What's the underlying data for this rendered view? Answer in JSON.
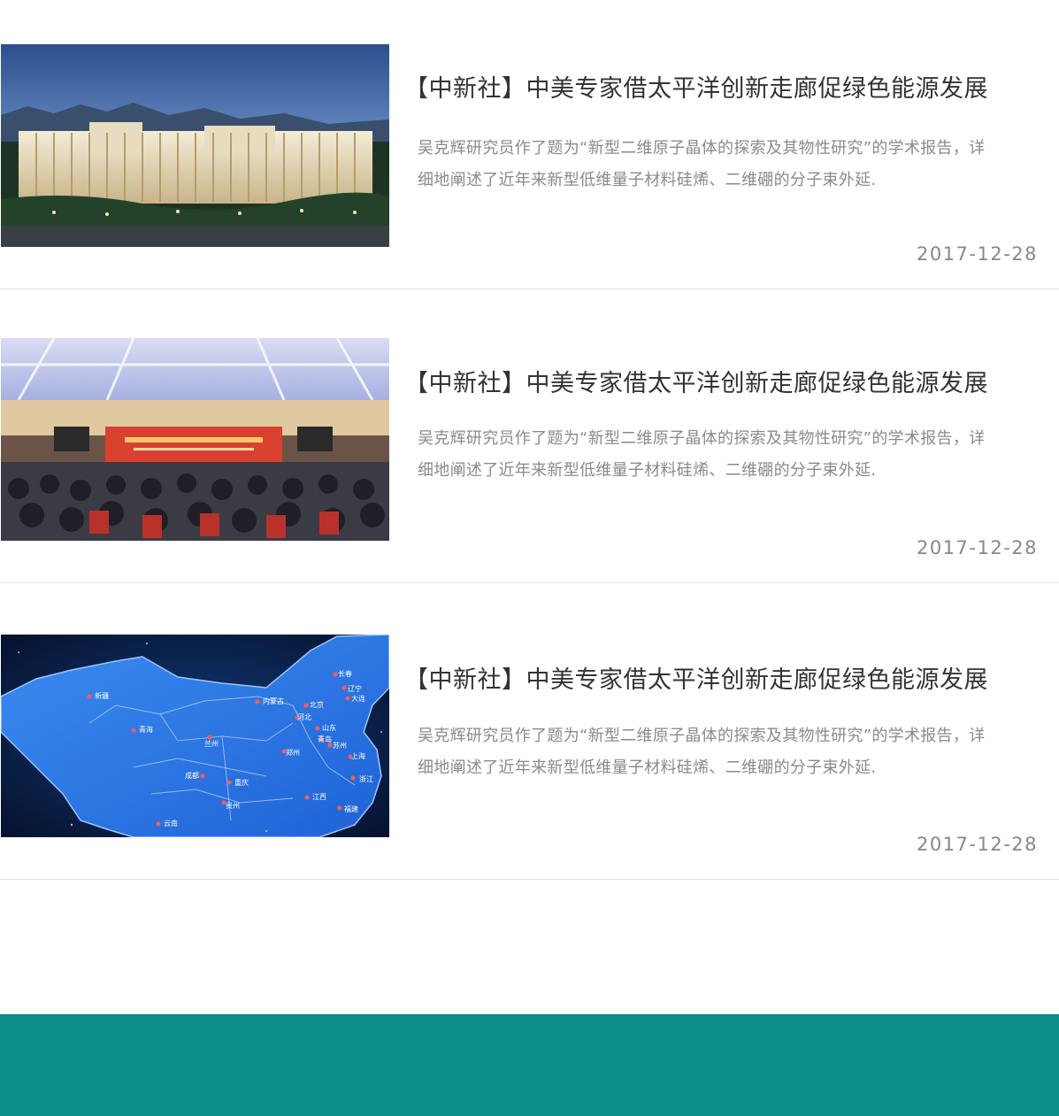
{
  "news": [
    {
      "title": "【中新社】中美专家借太平洋创新走廊促绿色能源发展",
      "summary": "吴克辉研究员作了题为“新型二维原子晶体的探索及其物性研究”的学术报告，详细地阐述了近年来新型低维量子材料硅烯、二维硼的分子束外延.",
      "date": "2017-12-28",
      "image": "building-photo"
    },
    {
      "title": "【中新社】中美专家借太平洋创新走廊促绿色能源发展",
      "summary": "吴克辉研究员作了题为“新型二维原子晶体的探索及其物性研究”的学术报告，详细地阐述了近年来新型低维量子材料硅烯、二维硼的分子束外延.",
      "date": "2017-12-28",
      "image": "conference-photo"
    },
    {
      "title": "【中新社】中美专家借太平洋创新走廊促绿色能源发展",
      "summary": "吴克辉研究员作了题为“新型二维原子晶体的探索及其物性研究”的学术报告，详细地阐述了近年来新型低维量子材料硅烯、二维硼的分子束外延.",
      "date": "2017-12-28",
      "image": "china-map-graphic"
    }
  ],
  "map_labels": [
    "新疆",
    "青海",
    "内蒙古",
    "北京",
    "河北",
    "山东",
    "青岛",
    "苏州",
    "郑州",
    "兰州",
    "成都",
    "重庆",
    "贵州",
    "云南",
    "江西",
    "福建",
    "浙江",
    "上海",
    "长春",
    "辽宁",
    "大连"
  ],
  "footer": {
    "color": "#0b8d8a"
  }
}
